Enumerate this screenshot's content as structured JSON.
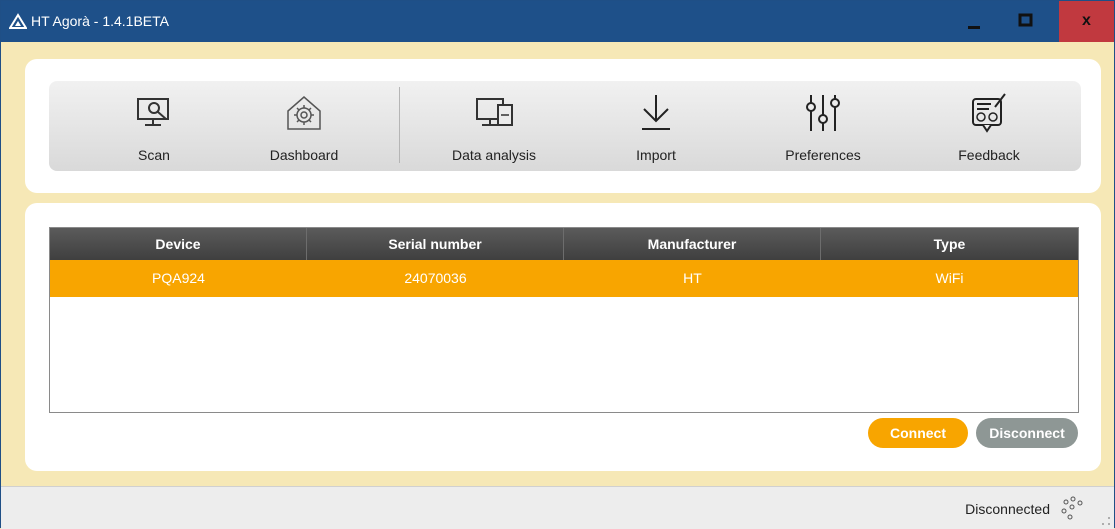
{
  "window": {
    "title": "HT Agorà - 1.4.1BETA",
    "controls": {
      "minimize": "–",
      "maximize": "□",
      "close": "x"
    },
    "colors": {
      "titlebar": "#1e5089",
      "close": "#c1393f"
    }
  },
  "toolbar": {
    "items": [
      {
        "label": "Scan",
        "icon": "scan-icon"
      },
      {
        "label": "Dashboard",
        "icon": "dashboard-icon"
      },
      {
        "label": "Data analysis",
        "icon": "data-analysis-icon"
      },
      {
        "label": "Import",
        "icon": "import-icon"
      },
      {
        "label": "Preferences",
        "icon": "preferences-icon"
      },
      {
        "label": "Feedback",
        "icon": "feedback-icon"
      }
    ]
  },
  "devices": {
    "columns": [
      "Device",
      "Serial number",
      "Manufacturer",
      "Type"
    ],
    "rows": [
      {
        "device": "PQA924",
        "serial": "24070036",
        "manufacturer": "HT",
        "type": "WiFi",
        "selected": true
      }
    ],
    "selected_color": "#f8a500"
  },
  "actions": {
    "connect": "Connect",
    "disconnect": "Disconnect"
  },
  "status": {
    "text": "Disconnected",
    "icon": "connection-status-icon"
  }
}
